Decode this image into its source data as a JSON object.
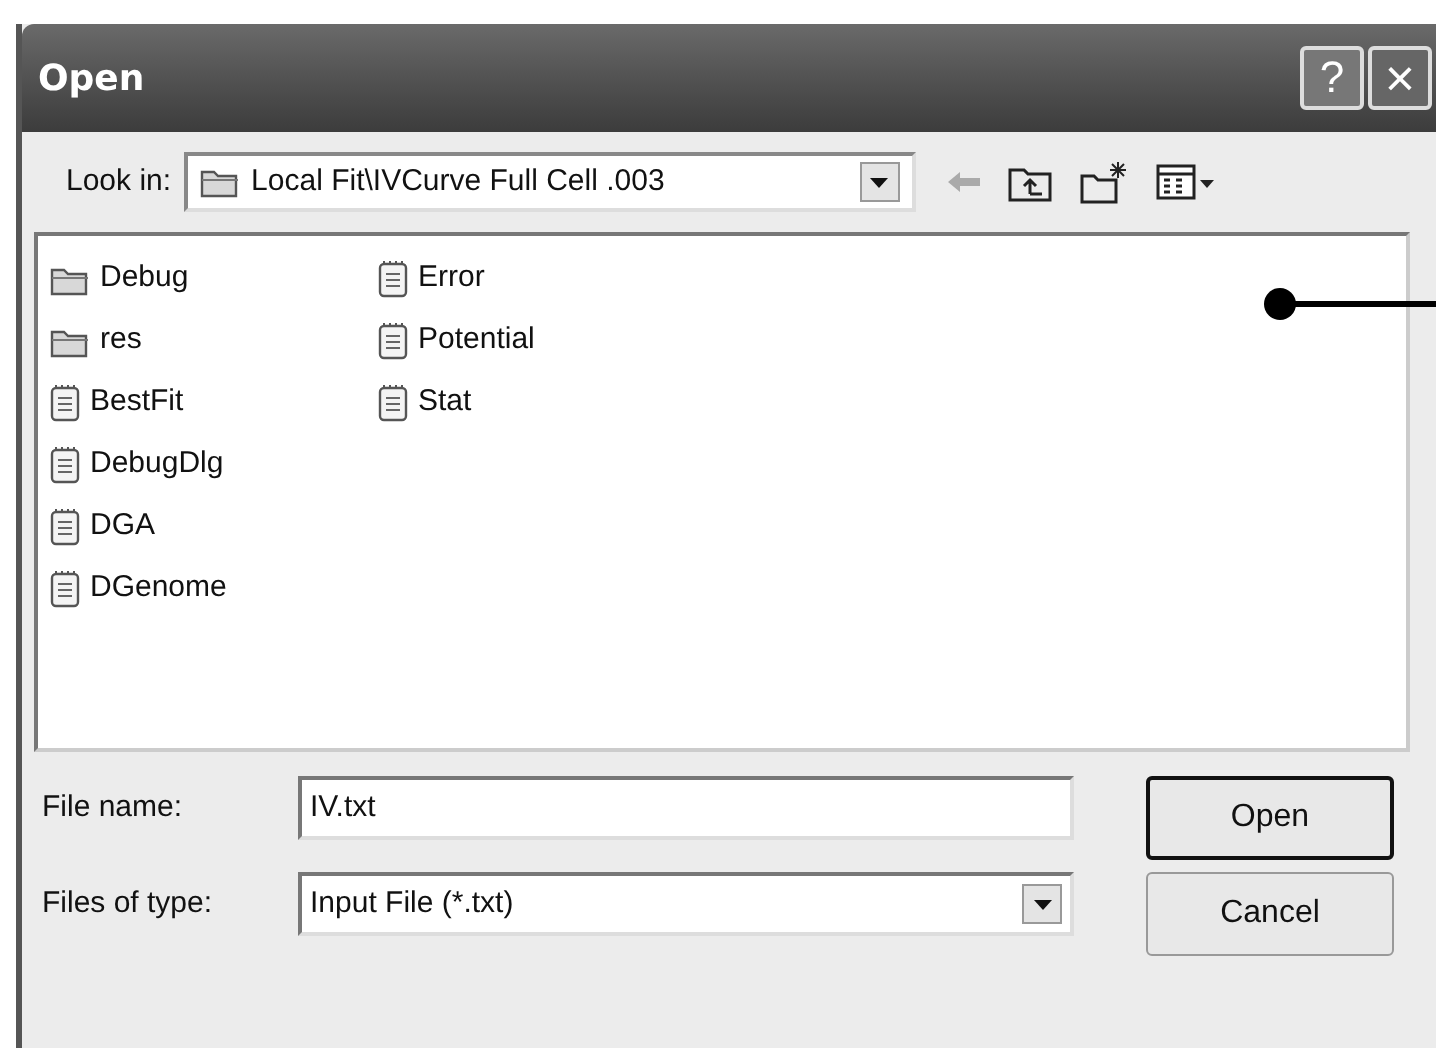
{
  "window": {
    "title": "Open",
    "help": "?",
    "close": "×"
  },
  "look_in": {
    "label": "Look in:",
    "value": "Local Fit\\IVCurve Full Cell .003"
  },
  "files": [
    {
      "name": "Debug",
      "kind": "folder"
    },
    {
      "name": "res",
      "kind": "folder"
    },
    {
      "name": "BestFit",
      "kind": "file"
    },
    {
      "name": "DebugDlg",
      "kind": "file"
    },
    {
      "name": "DGA",
      "kind": "file"
    },
    {
      "name": "DGenome",
      "kind": "file"
    },
    {
      "name": "Error",
      "kind": "file"
    },
    {
      "name": "Potential",
      "kind": "file"
    },
    {
      "name": "Stat",
      "kind": "file"
    }
  ],
  "file_name": {
    "label": "File name:",
    "value": "IV.txt"
  },
  "file_type": {
    "label": "Files of type:",
    "value": "Input File (*.txt)"
  },
  "buttons": [
    {
      "label": "Open",
      "default": true
    },
    {
      "label": "Cancel",
      "default": false
    }
  ]
}
